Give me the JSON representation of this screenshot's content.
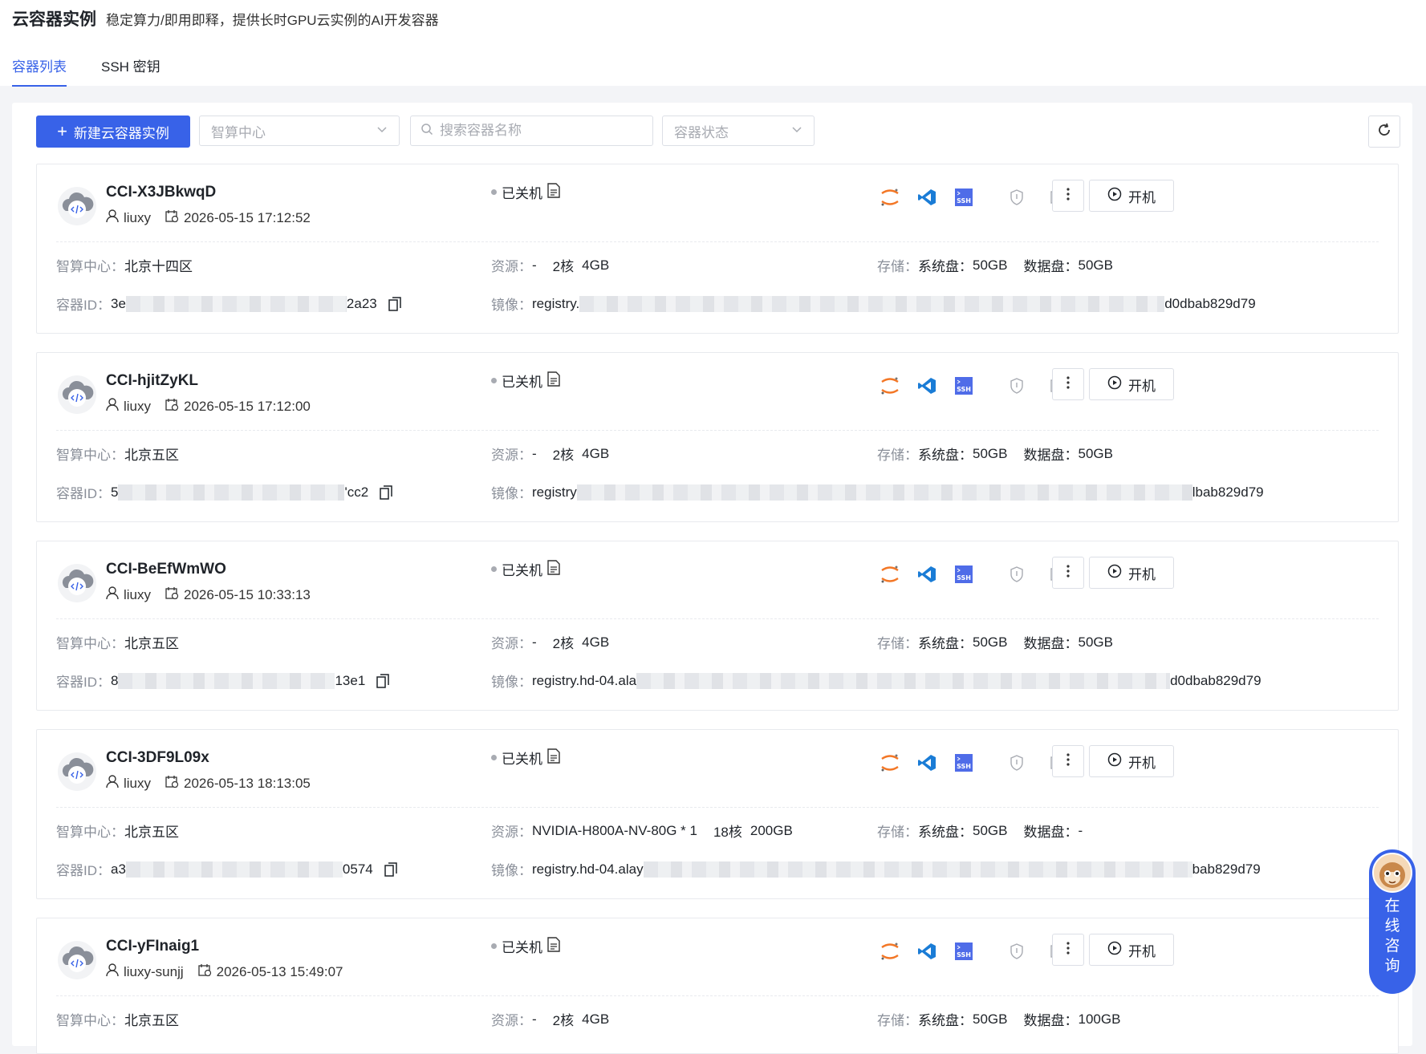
{
  "page": {
    "title": "云容器实例",
    "subtitle": "稳定算力/即用即释，提供长时GPU云实例的AI开发容器"
  },
  "tabs": [
    {
      "label": "容器列表",
      "active": true
    },
    {
      "label": "SSH 密钥",
      "active": false
    }
  ],
  "toolbar": {
    "create_label": "新建云容器实例",
    "center_placeholder": "智算中心",
    "search_placeholder": "搜索容器名称",
    "status_placeholder": "容器状态"
  },
  "labels": {
    "center": "智算中心：",
    "resource": "资源：",
    "storage": "存储：",
    "sysdisk": "系统盘：",
    "datadisk": "数据盘：",
    "container_id": "容器ID：",
    "image": "镜像：",
    "start": "开机"
  },
  "colors": {
    "primary": "#3862e8",
    "label": "#8a8f99",
    "status_dot": "#a8abb2"
  },
  "containers": [
    {
      "name": "CCI-X3JBkwqD",
      "user": "liuxy",
      "created": "2026-05-15 17:12:52",
      "status": "已关机",
      "center": "北京十四区",
      "resource": "-",
      "cpu": "2核",
      "mem": "4GB",
      "sys_disk": "50GB",
      "data_disk": "50GB",
      "id_start": "3e",
      "id_end": "2a23",
      "image_start": "registry.",
      "image_end": "d0dbab829d79"
    },
    {
      "name": "CCI-hjitZyKL",
      "user": "liuxy",
      "created": "2026-05-15 17:12:00",
      "status": "已关机",
      "center": "北京五区",
      "resource": "-",
      "cpu": "2核",
      "mem": "4GB",
      "sys_disk": "50GB",
      "data_disk": "50GB",
      "id_start": "5",
      "id_end": "'cc2",
      "image_start": "registry",
      "image_end": "lbab829d79"
    },
    {
      "name": "CCI-BeEfWmWO",
      "user": "liuxy",
      "created": "2026-05-15 10:33:13",
      "status": "已关机",
      "center": "北京五区",
      "resource": "-",
      "cpu": "2核",
      "mem": "4GB",
      "sys_disk": "50GB",
      "data_disk": "50GB",
      "id_start": "8",
      "id_end": "13e1",
      "image_start": "registry.hd-04.ala",
      "image_end": "d0dbab829d79"
    },
    {
      "name": "CCI-3DF9L09x",
      "user": "liuxy",
      "created": "2026-05-13 18:13:05",
      "status": "已关机",
      "center": "北京五区",
      "resource": "NVIDIA-H800A-NV-80G  * 1",
      "cpu": "18核",
      "mem": "200GB",
      "sys_disk": "50GB",
      "data_disk": "-",
      "id_start": "a3",
      "id_end": "0574",
      "image_start": "registry.hd-04.alay",
      "image_end": "bab829d79"
    },
    {
      "name": "CCI-yFInaig1",
      "user": "liuxy-sunjj",
      "created": "2026-05-13 15:49:07",
      "status": "已关机",
      "center": "北京五区",
      "resource": "-",
      "cpu": "2核",
      "mem": "4GB",
      "sys_disk": "50GB",
      "data_disk": "100GB",
      "id_start": "",
      "id_end": "",
      "image_start": "",
      "image_end": ""
    }
  ],
  "chat": {
    "label": "在线咨询"
  }
}
